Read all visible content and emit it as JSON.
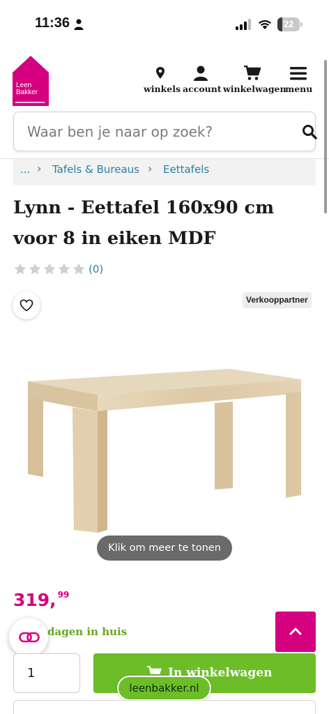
{
  "status_bar": {
    "time": "11:36",
    "battery_level": "22"
  },
  "brand": {
    "logo_line1": "Leen",
    "logo_line2": "Bakker",
    "primary_color": "#d5007f",
    "accent_green": "#6dbd28"
  },
  "nav": {
    "items": [
      {
        "label": "winkels",
        "icon": "location-pin-icon"
      },
      {
        "label": "account",
        "icon": "user-icon"
      },
      {
        "label": "winkelwagen",
        "icon": "cart-icon"
      },
      {
        "label": "menu",
        "icon": "hamburger-menu-icon"
      }
    ]
  },
  "search": {
    "placeholder": "Waar ben je naar op zoek?"
  },
  "breadcrumb": {
    "ellipsis": "...",
    "items": [
      "Tafels & Bureaus",
      "Eettafels"
    ]
  },
  "product": {
    "title_line1": "Lynn - Eettafel 160x90 cm",
    "title_line2": "voor 8 in eiken MDF",
    "rating": 0,
    "review_count": "(0)",
    "seller_badge": "Verkooppartner",
    "more_label": "Klik om meer te tonen",
    "price_main": "319,",
    "price_cents": "99",
    "delivery_text": "dagen in huis",
    "quantity": "1",
    "add_to_cart_label": "In winkelwagen"
  },
  "browser": {
    "url": "leenbakker.nl"
  }
}
